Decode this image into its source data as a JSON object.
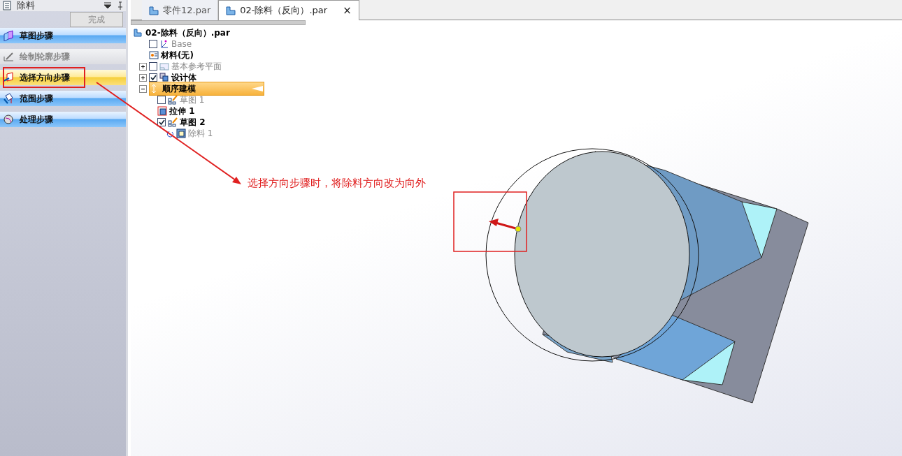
{
  "panel": {
    "title": "除料",
    "finish_button": {
      "label": "完成",
      "disabled": true
    }
  },
  "steps": [
    {
      "kind": "sketch",
      "label": "草图步骤",
      "selected": false,
      "disabled": false
    },
    {
      "kind": "profile",
      "label": "绘制轮廓步骤",
      "selected": false,
      "disabled": true
    },
    {
      "kind": "direction",
      "label": "选择方向步骤",
      "selected": true,
      "disabled": false
    },
    {
      "kind": "extent",
      "label": "范围步骤",
      "selected": false,
      "disabled": false
    },
    {
      "kind": "treatment",
      "label": "处理步骤",
      "selected": false,
      "disabled": false
    }
  ],
  "tabs": [
    {
      "label": "零件12.par",
      "selected": false,
      "closable": false
    },
    {
      "label": "02-除料（反向）.par",
      "selected": true,
      "closable": true,
      "close": "×"
    }
  ],
  "tree": {
    "label": "02-除料（反向）.par",
    "kind": "part",
    "children": [
      {
        "kind": "coord",
        "label": "Base",
        "checked": false,
        "dimmed": true,
        "bold": false
      },
      {
        "kind": "material",
        "label": "材料(无)",
        "dimmed": false,
        "bold": true
      },
      {
        "kind": "plane",
        "label": "基本参考平面",
        "checked": false,
        "expanded": false,
        "dimmed": true,
        "bold": false
      },
      {
        "kind": "body",
        "label": "设计体",
        "checked": true,
        "expanded": false,
        "dimmed": false,
        "bold": true
      },
      {
        "kind": "ordered",
        "label": "顺序建模",
        "expanded": true,
        "selected": true,
        "dimmed": false,
        "bold": true,
        "children": [
          {
            "kind": "sketch",
            "label": "草图 1",
            "checked": false,
            "dimmed": true,
            "bold": false
          },
          {
            "kind": "extrude",
            "label": "拉伸 1",
            "dimmed": false,
            "bold": true
          },
          {
            "kind": "sketch",
            "label": "草图 2",
            "checked": true,
            "dimmed": false,
            "bold": true,
            "children": [
              {
                "kind": "cutout",
                "label": "除料 1",
                "dimmed": true,
                "bold": false
              }
            ]
          }
        ]
      }
    ]
  },
  "annotation": {
    "text": "选择方向步骤时，将除料方向改为向外"
  }
}
